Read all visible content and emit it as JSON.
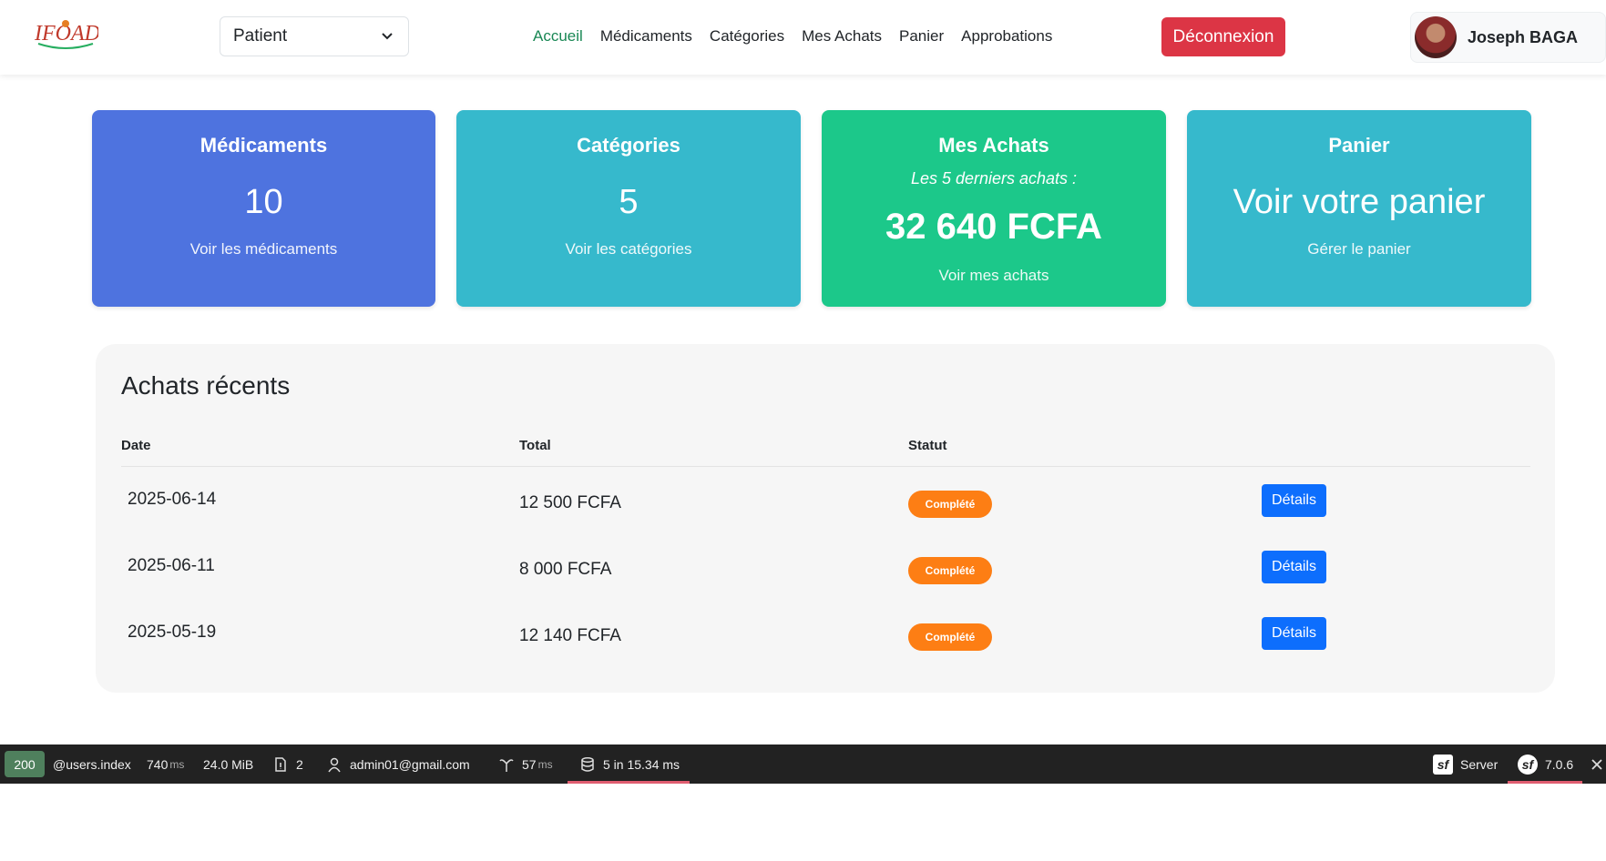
{
  "header": {
    "logo_text": "IFOAD",
    "role_select": {
      "value": "Patient",
      "icon": "chevron-down-icon"
    },
    "nav": [
      {
        "label": "Accueil",
        "active": true
      },
      {
        "label": "Médicaments",
        "active": false
      },
      {
        "label": "Catégories",
        "active": false
      },
      {
        "label": "Mes Achats",
        "active": false
      },
      {
        "label": "Panier",
        "active": false
      },
      {
        "label": "Approbations",
        "active": false
      }
    ],
    "logout_label": "Déconnexion",
    "user_name": "Joseph BAGA"
  },
  "cards": {
    "medicaments": {
      "title": "Médicaments",
      "value": "10",
      "link": "Voir les médicaments",
      "color": "#4e73df"
    },
    "categories": {
      "title": "Catégories",
      "value": "5",
      "link": "Voir les catégories",
      "color": "#36b9cc"
    },
    "achats": {
      "title": "Mes Achats",
      "subtitle": "Les 5 derniers achats :",
      "value": "32 640 FCFA",
      "link": "Voir mes achats",
      "color": "#1cc88a"
    },
    "panier": {
      "title": "Panier",
      "value": "Voir votre panier",
      "link": "Gérer le panier",
      "color": "#36b9cc"
    }
  },
  "recent": {
    "title": "Achats récents",
    "columns": [
      "Date",
      "Total",
      "Statut"
    ],
    "rows": [
      {
        "date": "2025-06-14",
        "total": "12 500 FCFA",
        "status": "Complété",
        "action": "Détails"
      },
      {
        "date": "2025-06-11",
        "total": "8 000 FCFA",
        "status": "Complété",
        "action": "Détails"
      },
      {
        "date": "2025-05-19",
        "total": "12 140 FCFA",
        "status": "Complété",
        "action": "Détails"
      }
    ],
    "status_color": "#fd7e14",
    "action_color": "#0d6efd"
  },
  "debug_toolbar": {
    "status_code": "200",
    "route": "@users.index",
    "time_value": "740",
    "time_unit": "ms",
    "memory": "24.0 MiB",
    "forms": "2",
    "user": "admin01@gmail.com",
    "twig_value": "57",
    "twig_unit": "ms",
    "db": "5 in 15.34 ms",
    "server_label": "Server",
    "version": "7.0.6"
  }
}
